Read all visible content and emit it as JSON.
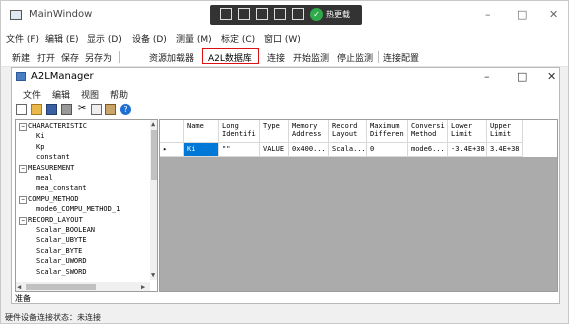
{
  "main_window": {
    "title": "MainWindow",
    "controls": [
      "–",
      "□",
      "✕"
    ]
  },
  "overlay_bar": {
    "live_label": "热更载"
  },
  "menubar": [
    "文件 (F)",
    "编辑 (E)",
    "显示 (D)",
    "设备 (D)",
    "测量 (M)",
    "标定 (C)",
    "窗口 (W)"
  ],
  "toolbar": [
    "新建",
    "打开",
    "保存",
    "另存为",
    "资源加载器",
    "A2L数据库",
    "连接",
    "开始监测",
    "停止监测",
    "连接配置"
  ],
  "child": {
    "title": "A2LManager",
    "controls": [
      "–",
      "□",
      "✕"
    ],
    "menu": [
      "文件",
      "编辑",
      "视图",
      "帮助"
    ],
    "tools": [
      "new-icon",
      "open-icon",
      "save-icon",
      "print-icon",
      "cut-icon",
      "copy-icon",
      "paste-icon",
      "help-icon"
    ],
    "tree": [
      {
        "label": "CHARACTERISTIC",
        "level": 0,
        "expanded": true
      },
      {
        "label": "Ki",
        "level": 1
      },
      {
        "label": "Kp",
        "level": 1
      },
      {
        "label": "constant",
        "level": 1
      },
      {
        "label": "MEASUREMENT",
        "level": 0,
        "expanded": true
      },
      {
        "label": "meal",
        "level": 1
      },
      {
        "label": "mea_constant",
        "level": 1
      },
      {
        "label": "COMPU_METHOD",
        "level": 0,
        "expanded": true
      },
      {
        "label": "mode6_COMPU_METHOD_1",
        "level": 1
      },
      {
        "label": "RECORD_LAYOUT",
        "level": 0,
        "expanded": true
      },
      {
        "label": "Scalar_BOOLEAN",
        "level": 1
      },
      {
        "label": "Scalar_UBYTE",
        "level": 1
      },
      {
        "label": "Scalar_BYTE",
        "level": 1
      },
      {
        "label": "Scalar_UWORD",
        "level": 1
      },
      {
        "label": "Scalar_SWORD",
        "level": 1
      }
    ],
    "grid": {
      "columns": [
        "Name",
        "Long Identifi",
        "Type",
        "Memory Address",
        "Record Layout",
        "Maximum Differen",
        "Conversi Method",
        "Lower Limit",
        "Upper Limit"
      ],
      "row": [
        "Ki",
        "\"\"",
        "VALUE",
        "0x400...",
        "Scala...",
        "0",
        "mode6...",
        "-3.4E+38",
        "3.4E+38"
      ],
      "row_marker": "▸"
    },
    "status": "准备"
  },
  "main_status": "硬件设备连接状态：未连接"
}
